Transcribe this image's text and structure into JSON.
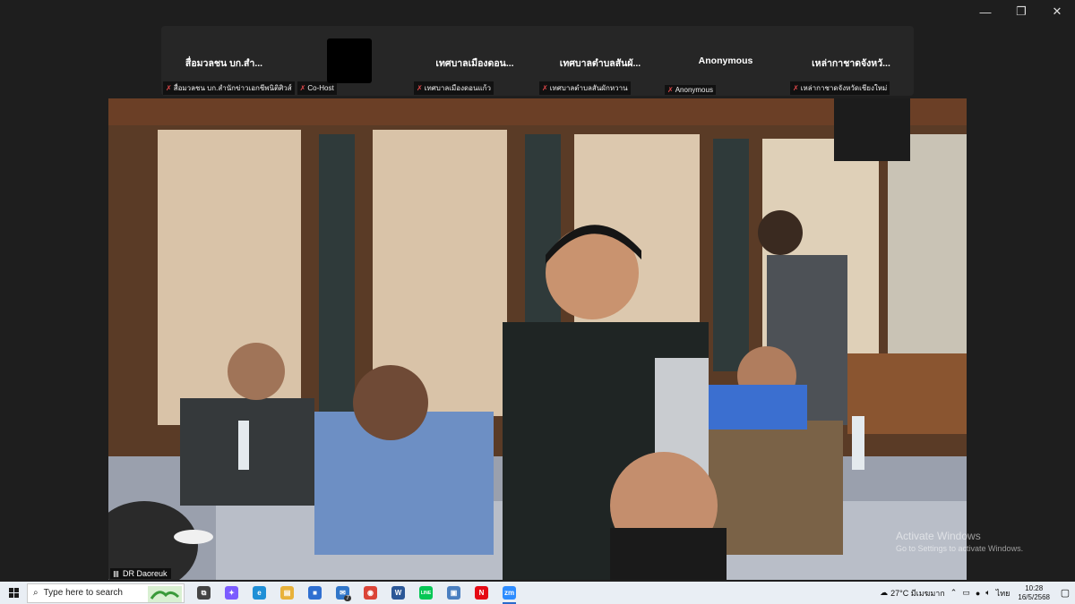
{
  "window": {
    "minimize_glyph": "—",
    "restore_glyph": "❐",
    "close_glyph": "✕"
  },
  "participants": [
    {
      "tile_title": "สื่อมวลชน บก.สำ...",
      "tags": [
        "สื่อมวลชน บก.สำนักข่าวเอกชีพนิติศิวส์",
        "Co-Host"
      ],
      "video_off_box": false
    },
    {
      "tile_title": "",
      "tags": [],
      "video_off_box": true
    },
    {
      "tile_title": "เทศบาลเมืองดอน...",
      "tags": [
        "เทศบาลเมืองดอนแก้ว"
      ],
      "video_off_box": false
    },
    {
      "tile_title": "เทศบาลตำบลสันผั...",
      "tags": [
        "เทศบาลตำบลสันผักหวาน"
      ],
      "video_off_box": false
    },
    {
      "tile_title": "Anonymous",
      "tags": [
        "Anonymous"
      ],
      "video_off_box": false
    },
    {
      "tile_title": "เหล่ากาชาดจังหวั...",
      "tags": [
        "เหล่ากาชาดจังหวัดเชียงใหม่"
      ],
      "video_off_box": false
    }
  ],
  "main_video": {
    "speaker_name": "DR Daoreuk"
  },
  "activation_watermark": {
    "line1": "Activate Windows",
    "line2": "Go to Settings to activate Windows."
  },
  "taskbar": {
    "search_placeholder": "Type here to search",
    "apps": [
      {
        "name": "task-view",
        "label": "⧉",
        "color": "#444444"
      },
      {
        "name": "copilot",
        "label": "✦",
        "color": "#7b5cff"
      },
      {
        "name": "edge",
        "label": "e",
        "color": "#1f8fd6"
      },
      {
        "name": "file-explorer",
        "label": "▤",
        "color": "#e8b23a"
      },
      {
        "name": "store",
        "label": "■",
        "color": "#2f6fd1"
      },
      {
        "name": "mail",
        "label": "✉",
        "color": "#3076c9",
        "badge": "7"
      },
      {
        "name": "chrome",
        "label": "◉",
        "color": "#db4437"
      },
      {
        "name": "word",
        "label": "W",
        "color": "#2b5797"
      },
      {
        "name": "line",
        "label": "LINE",
        "color": "#06c755"
      },
      {
        "name": "photos",
        "label": "▣",
        "color": "#4a7fc0"
      },
      {
        "name": "netflix",
        "label": "N",
        "color": "#e50914"
      },
      {
        "name": "zoom",
        "label": "zm",
        "color": "#2d8cff",
        "active": true
      }
    ],
    "weather": "27°C มีเมฆมาก",
    "language": "ไทย",
    "time": "10:28",
    "date": "16/5/2568"
  },
  "colors": {
    "mic_off": "#e0484a",
    "taskbar_bg": "#e9eef4",
    "strip_bg": "#262626"
  }
}
